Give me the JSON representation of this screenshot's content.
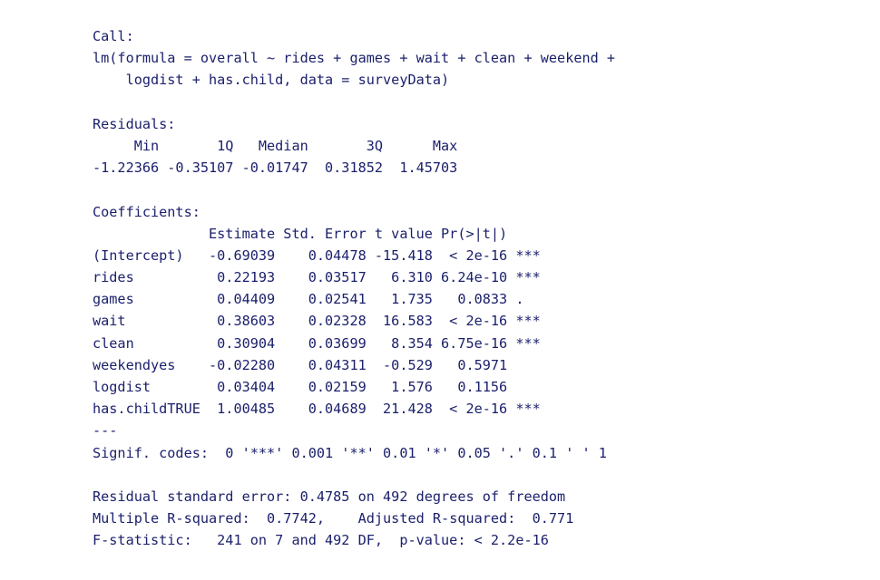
{
  "output": {
    "lines": [
      "Call:",
      "lm(formula = overall ~ rides + games + wait + clean + weekend +",
      "    logdist + has.child, data = surveyData)",
      "",
      "Residuals:",
      "     Min       1Q   Median       3Q      Max",
      "-1.22366 -0.35107 -0.01747  0.31852  1.45703",
      "",
      "Coefficients:",
      "              Estimate Std. Error t value Pr(>|t|)    ",
      "(Intercept)   -0.69039    0.04478 -15.418  < 2e-16 ***",
      "rides          0.22193    0.03517   6.310 6.24e-10 ***",
      "games          0.04409    0.02541   1.735   0.0833 .  ",
      "wait           0.38603    0.02328  16.583  < 2e-16 ***",
      "clean          0.30904    0.03699   8.354 6.75e-16 ***",
      "weekendyes    -0.02280    0.04311  -0.529   0.5971    ",
      "logdist        0.03404    0.02159   1.576   0.1156    ",
      "has.childTRUE  1.00485    0.04689  21.428  < 2e-16 ***",
      "---",
      "Signif. codes:  0 '***' 0.001 '**' 0.01 '*' 0.05 '.' 0.1 ' ' 1",
      "",
      "Residual standard error: 0.4785 on 492 degrees of freedom",
      "Multiple R-squared:  0.7742,\tAdjusted R-squared:  0.771 ",
      "F-statistic:   241 on 7 and 492 DF,  p-value: < 2.2e-16"
    ]
  }
}
